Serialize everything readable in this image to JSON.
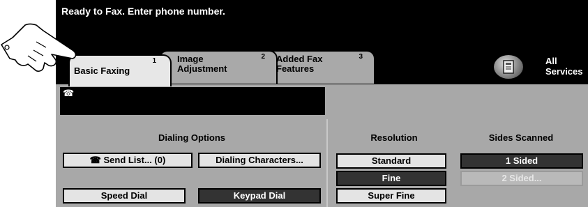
{
  "status_message": "Ready to Fax. Enter phone number.",
  "tabs": [
    {
      "label_line1": "Basic Faxing",
      "label_line2": "",
      "number": "1"
    },
    {
      "label_line1": "Image",
      "label_line2": "Adjustment",
      "number": "2"
    },
    {
      "label_line1": "Added Fax",
      "label_line2": "Features",
      "number": "3"
    }
  ],
  "all_services": {
    "line1": "All",
    "line2": "Services",
    "icon": "all-services-icon"
  },
  "phone_field": {
    "glyph": "☎",
    "value": ""
  },
  "dialing_options": {
    "title": "Dialing Options",
    "send_list": "☎ Send List... (0)",
    "dialing_characters": "Dialing Characters...",
    "speed_dial": "Speed Dial",
    "keypad_dial": "Keypad Dial"
  },
  "resolution": {
    "title": "Resolution",
    "options": [
      "Standard",
      "Fine",
      "Super Fine"
    ],
    "selected": "Fine"
  },
  "sides_scanned": {
    "title": "Sides Scanned",
    "options": [
      "1 Sided",
      "2 Sided..."
    ],
    "selected": "1 Sided"
  },
  "colors": {
    "screen_bg": "#000000",
    "panel_bg": "#a8a8a8",
    "selected": "#333333",
    "button": "#e4e4e4"
  }
}
